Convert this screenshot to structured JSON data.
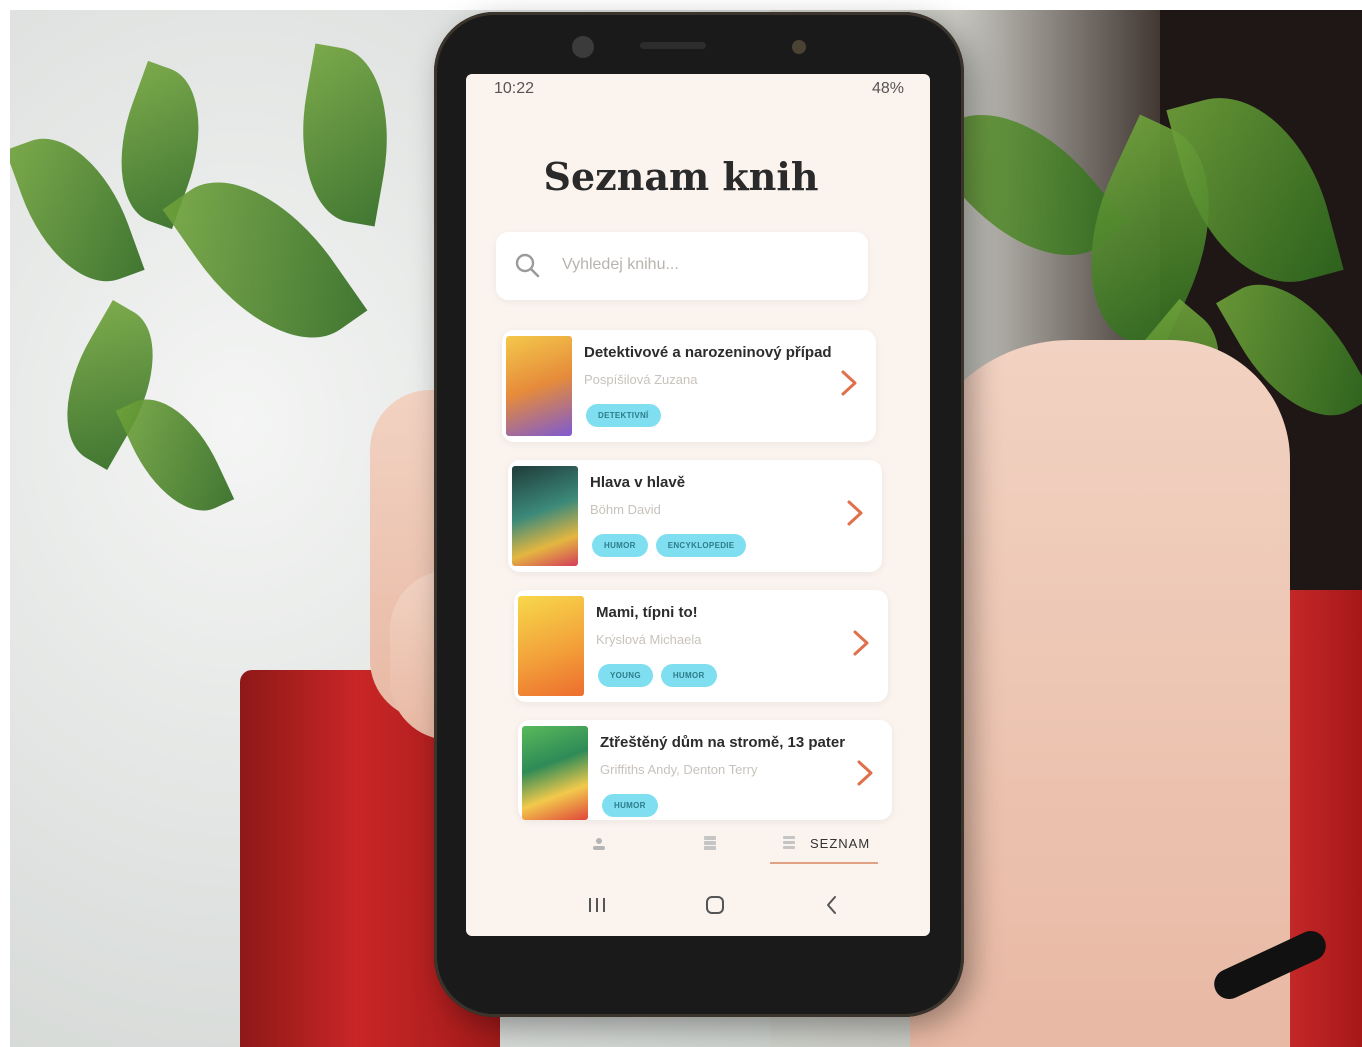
{
  "status_bar": {
    "time": "10:22",
    "battery": "48%"
  },
  "app": {
    "title": "Seznam knih",
    "search_placeholder": "Vyhledej knihu...",
    "books": [
      {
        "title": "Detektivové a narozeninový případ",
        "author": "Pospíšilová Zuzana",
        "tags": [
          "DETEKTIVNÍ"
        ]
      },
      {
        "title": "Hlava v hlavě",
        "author": "Böhm David",
        "tags": [
          "HUMOR",
          "ENCYKLOPEDIE"
        ]
      },
      {
        "title": "Mami, típni to!",
        "author": "Krýslová Michaela",
        "tags": [
          "YOUNG",
          "HUMOR"
        ]
      },
      {
        "title": "Ztřeštěný dům na stromě, 13 pater",
        "author": "Griffiths Andy, Denton Terry",
        "tags": [
          "HUMOR"
        ]
      }
    ],
    "bottom_nav": {
      "active_label": "SEZNAM"
    }
  },
  "colors": {
    "tag_bg": "#7fdff0",
    "chevron": "#e0704a",
    "screen_bg": "#fbf3ee"
  },
  "icons": [
    "search-icon",
    "chevron-right-icon",
    "profile-icon",
    "books-icon",
    "list-icon",
    "recents-icon",
    "home-icon",
    "back-icon"
  ]
}
